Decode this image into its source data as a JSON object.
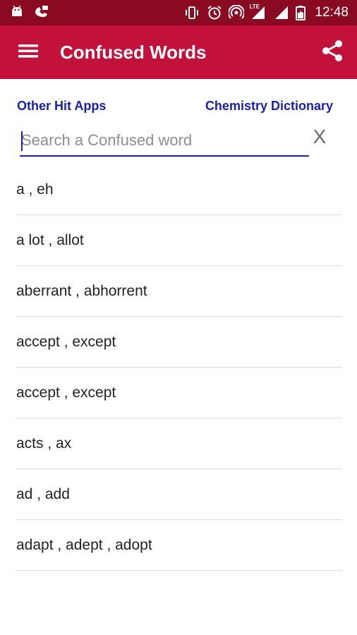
{
  "status_bar": {
    "time": "12:48",
    "lte_label": "LTE",
    "icons": [
      "android-icon",
      "phone-call-icon",
      "vibrate-icon",
      "alarm-icon",
      "hotspot-icon",
      "signal-icon",
      "signal-icon",
      "battery-icon"
    ]
  },
  "app_bar": {
    "title": "Confused Words",
    "colors": {
      "app_bar": "#c2123b",
      "status_bar": "#8a0a22"
    }
  },
  "links": {
    "other_apps": "Other Hit Apps",
    "chemistry": "Chemistry Dictionary",
    "color": "#1a1fa8"
  },
  "search": {
    "placeholder": "Search a Confused word",
    "value": "",
    "clear_label": "X"
  },
  "words": [
    "a , eh",
    "a lot , allot",
    "aberrant , abhorrent",
    "accept , except",
    "accept , except",
    "acts , ax",
    "ad , add",
    "adapt , adept , adopt"
  ]
}
